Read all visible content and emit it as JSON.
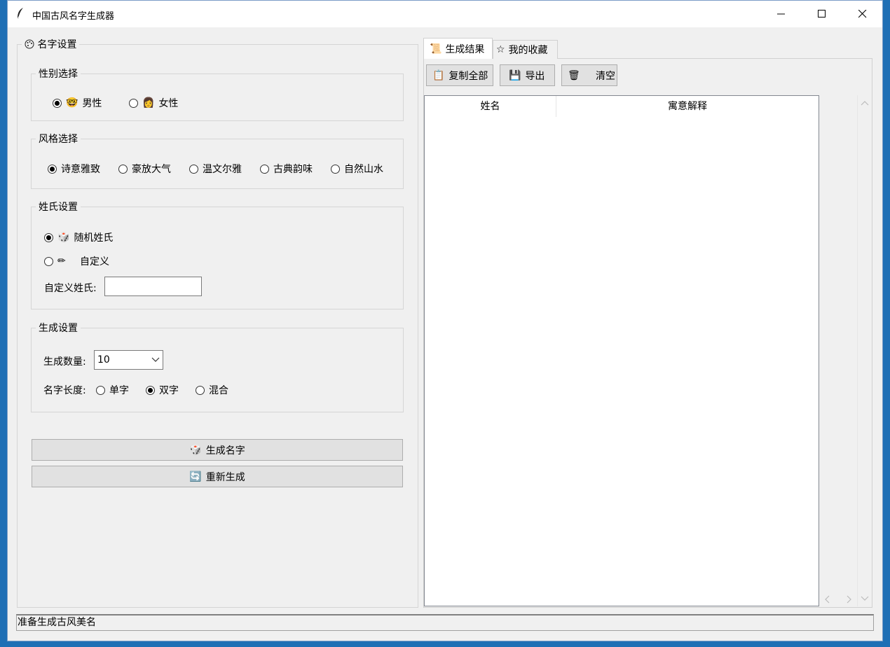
{
  "window": {
    "title": "中国古风名字生成器",
    "icons": {
      "app": "feather-icon",
      "minimize": "minimize-icon",
      "maximize": "maximize-icon",
      "close": "close-icon"
    }
  },
  "settings": {
    "title": "名字设置",
    "icon": "palette-icon",
    "gender": {
      "title": "性别选择",
      "options": [
        {
          "emoji": "🤓",
          "label": "男性",
          "selected": true
        },
        {
          "emoji": "👩",
          "label": "女性",
          "selected": false
        }
      ]
    },
    "style": {
      "title": "风格选择",
      "options": [
        {
          "label": "诗意雅致",
          "selected": true
        },
        {
          "label": "豪放大气",
          "selected": false
        },
        {
          "label": "温文尔雅",
          "selected": false
        },
        {
          "label": "古典韵味",
          "selected": false
        },
        {
          "label": "自然山水",
          "selected": false
        }
      ]
    },
    "surname": {
      "title": "姓氏设置",
      "options": [
        {
          "emoji": "🎲",
          "label": "随机姓氏",
          "selected": true
        },
        {
          "emoji": "✏",
          "label": "自定义",
          "selected": false
        }
      ],
      "custom_label": "自定义姓氏:",
      "custom_value": ""
    },
    "generate": {
      "title": "生成设置",
      "count_label": "生成数量:",
      "count_value": "10",
      "length_label": "名字长度:",
      "length_options": [
        {
          "label": "单字",
          "selected": false
        },
        {
          "label": "双字",
          "selected": true
        },
        {
          "label": "混合",
          "selected": false
        }
      ]
    },
    "buttons": {
      "generate": {
        "emoji": "🎲",
        "label": "生成名字"
      },
      "regenerate": {
        "emoji": "🔄",
        "label": "重新生成"
      }
    }
  },
  "results": {
    "tabs": [
      {
        "emoji": "📜",
        "label": "生成结果",
        "active": true
      },
      {
        "emoji": "☆",
        "label": "我的收藏",
        "active": false
      }
    ],
    "toolbar": [
      {
        "emoji": "📋",
        "label": "复制全部"
      },
      {
        "emoji": "💾",
        "label": "导出"
      },
      {
        "emoji": "🗑",
        "label": "清空"
      }
    ],
    "columns": [
      "姓名",
      "寓意解释"
    ],
    "rows": []
  },
  "status": "准备生成古风美名"
}
